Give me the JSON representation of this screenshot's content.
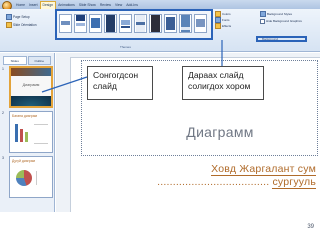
{
  "ribbon": {
    "tabs": [
      "Home",
      "Insert",
      "Design",
      "Animations",
      "Slide Show",
      "Review",
      "View",
      "Add-Ins"
    ],
    "active_tab": "Design",
    "left_buttons": [
      "Page Setup",
      "Slide Orientation"
    ],
    "themes_label": "Themes",
    "options": [
      "Colors",
      "Fonts",
      "Effects"
    ],
    "background_styles": "Background Styles",
    "hide_background": "Hide Background Graphics",
    "background_label": "Background"
  },
  "pane": {
    "tabs": [
      "Slides",
      "Outline"
    ],
    "thumbnails": [
      {
        "num": "1",
        "title": "Диаграмм"
      },
      {
        "num": "2",
        "title": "Багана диаграм"
      },
      {
        "num": "3",
        "title": "Дугуй диаграм"
      }
    ]
  },
  "callouts": {
    "selected_slide": "Сонгогдсон слайд",
    "next_slide_themes": "Дараах слайд солигдох хором"
  },
  "slide": {
    "title": "Диаграмм",
    "subtitle_line1": "Ховд Жаргалант сум",
    "subtitle_line2_dots": "....................................",
    "subtitle_line2_word": "сургууль"
  },
  "page_number": "39",
  "colors": {
    "highlight": "#2b63b8",
    "accent_text": "#b06b2a",
    "ribbon_bg": "#d6e3f3"
  }
}
